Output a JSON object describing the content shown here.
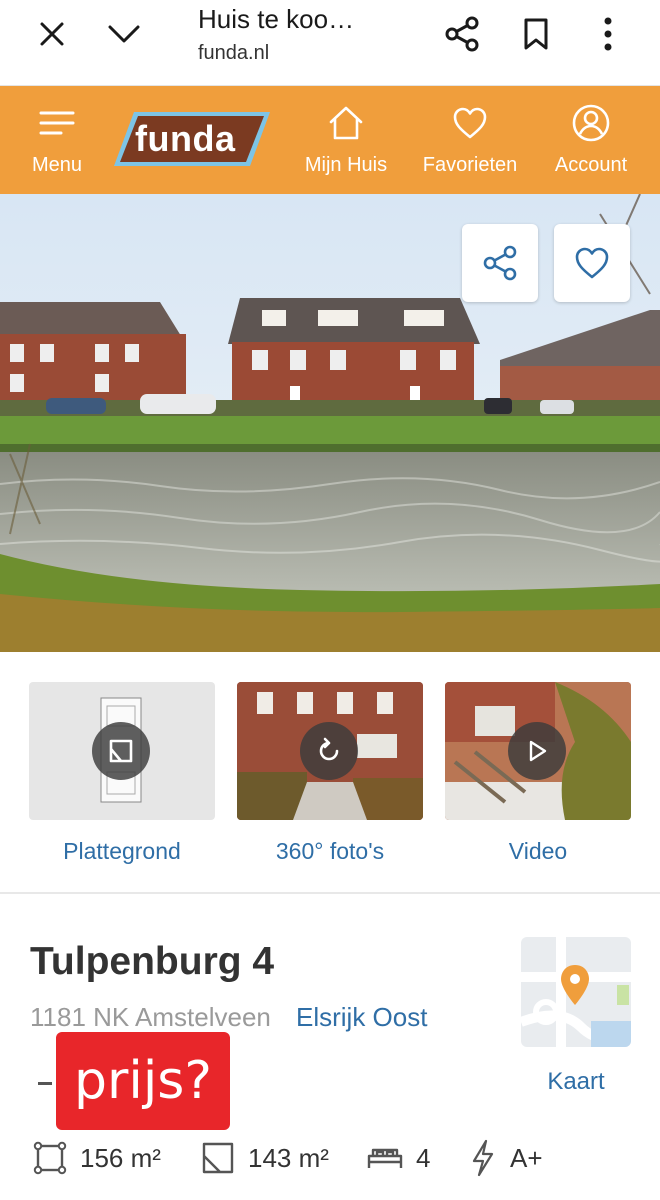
{
  "browser": {
    "title": "Huis te koo…",
    "url": "funda.nl",
    "close_icon": "close-icon",
    "collapse_icon": "chevron-down-icon",
    "share_icon": "share-icon",
    "bookmark_icon": "bookmark-icon",
    "more_icon": "more-vertical-icon"
  },
  "header": {
    "background": "#f09e3c",
    "logo_text": "funda",
    "nav": [
      {
        "label": "Menu",
        "icon": "menu-icon"
      },
      {
        "label": "Mijn Huis",
        "icon": "home-icon"
      },
      {
        "label": "Favorieten",
        "icon": "heart-icon"
      },
      {
        "label": "Account",
        "icon": "user-icon"
      }
    ]
  },
  "hero": {
    "share_icon": "share-icon",
    "favorite_icon": "heart-icon"
  },
  "media": [
    {
      "label": "Plattegrond",
      "icon": "floorplan-icon"
    },
    {
      "label": "360° foto's",
      "icon": "rotate-360-icon"
    },
    {
      "label": "Video",
      "icon": "play-icon"
    }
  ],
  "listing": {
    "street": "Tulpenburg 4",
    "postal_city": "1181 NK Amstelveen",
    "neighbourhood": "Elsrijk Oost",
    "price_overlay": "prijs?",
    "map_label": "Kaart",
    "features": [
      {
        "icon": "living-area-icon",
        "value": "156 m²"
      },
      {
        "icon": "plot-area-icon",
        "value": "143 m²"
      },
      {
        "icon": "bedroom-icon",
        "value": "4"
      },
      {
        "icon": "energy-label-icon",
        "value": "A+"
      }
    ]
  },
  "colors": {
    "brand_orange": "#f09e3c",
    "link_blue": "#2f6ea6",
    "overlay_red": "#e8262a"
  }
}
